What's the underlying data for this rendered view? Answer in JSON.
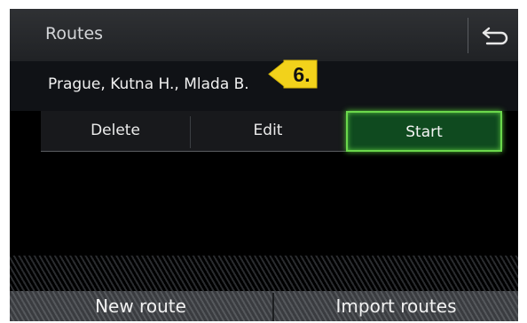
{
  "header": {
    "title": "Routes",
    "back_icon": "back-arrow-icon"
  },
  "route": {
    "name": "Prague, Kutna H., Mlada B."
  },
  "callout": {
    "label": "6.",
    "color": "#f2d21b"
  },
  "actions": {
    "delete_label": "Delete",
    "edit_label": "Edit",
    "start_label": "Start",
    "start_color": "#6bd84c"
  },
  "bottom": {
    "new_route_label": "New route",
    "import_routes_label": "Import routes"
  }
}
